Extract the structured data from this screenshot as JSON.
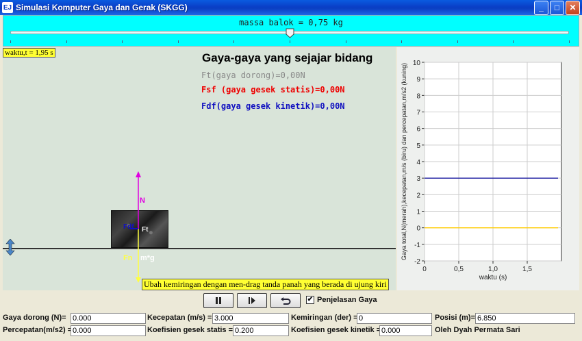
{
  "window": {
    "title": "Simulasi Komputer Gaya dan Gerak (SKGG)",
    "icon_text": "EJ",
    "minimize": "_",
    "maximize": "□",
    "close": "✕"
  },
  "slider": {
    "label": "massa balok = 0,75 kg",
    "value": 0.75,
    "ticks": 11
  },
  "sim": {
    "time_label": "waktu,t = 1,95 s",
    "forces_title": "Gaya-gaya yang sejajar bidang",
    "force_push": "Ft(gaya dorong)=0,00N",
    "force_static": "Fsf (gaya gesek statis)=0,00N",
    "force_kinetic": "Fdf(gaya gesek kinetik)=0,00N",
    "label_N": "N",
    "label_mg": "m*g",
    "label_ft": "Ft",
    "label_fn": "Fn",
    "label_fdf": "Fdf",
    "hint": "Ubah kemiringan dengan men-drag tanda panah yang berada di ujung kiri",
    "colors": {
      "normal": "#e000e0",
      "gravity": "#ffff40",
      "push": "#888888",
      "kinetic": "#1010c0"
    }
  },
  "chart_data": {
    "type": "line",
    "xlabel": "waktu (s)",
    "ylabel": "Gaya total,N(merah),kecepatan,m/s (biru) dan percepatan,m/s2 (kuning)",
    "xlim": [
      0,
      2
    ],
    "ylim": [
      -2,
      10
    ],
    "xticks": [
      0,
      0.5,
      1.0,
      1.5
    ],
    "xtick_labels": [
      "0",
      "0,5",
      "1,0",
      "1,5"
    ],
    "yticks": [
      -2,
      -1,
      0,
      1,
      2,
      3,
      4,
      5,
      6,
      7,
      8,
      9,
      10
    ],
    "grid": true,
    "series": [
      {
        "color": "#1a1aa0",
        "x": [
          0,
          1.95
        ],
        "y": [
          3,
          3
        ]
      },
      {
        "color": "#ffcc00",
        "x": [
          0,
          1.95
        ],
        "y": [
          0,
          0
        ]
      }
    ]
  },
  "controls": {
    "show_forces_label": "Penjelasan Gaya",
    "show_forces_checked": true
  },
  "fields": {
    "gaya_dorong_label": "Gaya dorong (N)=",
    "gaya_dorong_value": "0.000",
    "kecepatan_label": "Kecepatan (m/s) =",
    "kecepatan_value": "3.000",
    "kemiringan_label": "Kemiringan (der) =",
    "kemiringan_value": "0",
    "posisi_label": "Posisi (m)=",
    "posisi_value": "6.850",
    "percepatan_label": "Percepatan(m/s2) =",
    "percepatan_value": "0.000",
    "koef_statis_label": "Koefisien gesek statis =",
    "koef_statis_value": "0.200",
    "koef_kinetik_label": "Koefisien gesek kinetik =",
    "koef_kinetik_value": "0.000",
    "author": "Oleh Dyah Permata Sari"
  }
}
